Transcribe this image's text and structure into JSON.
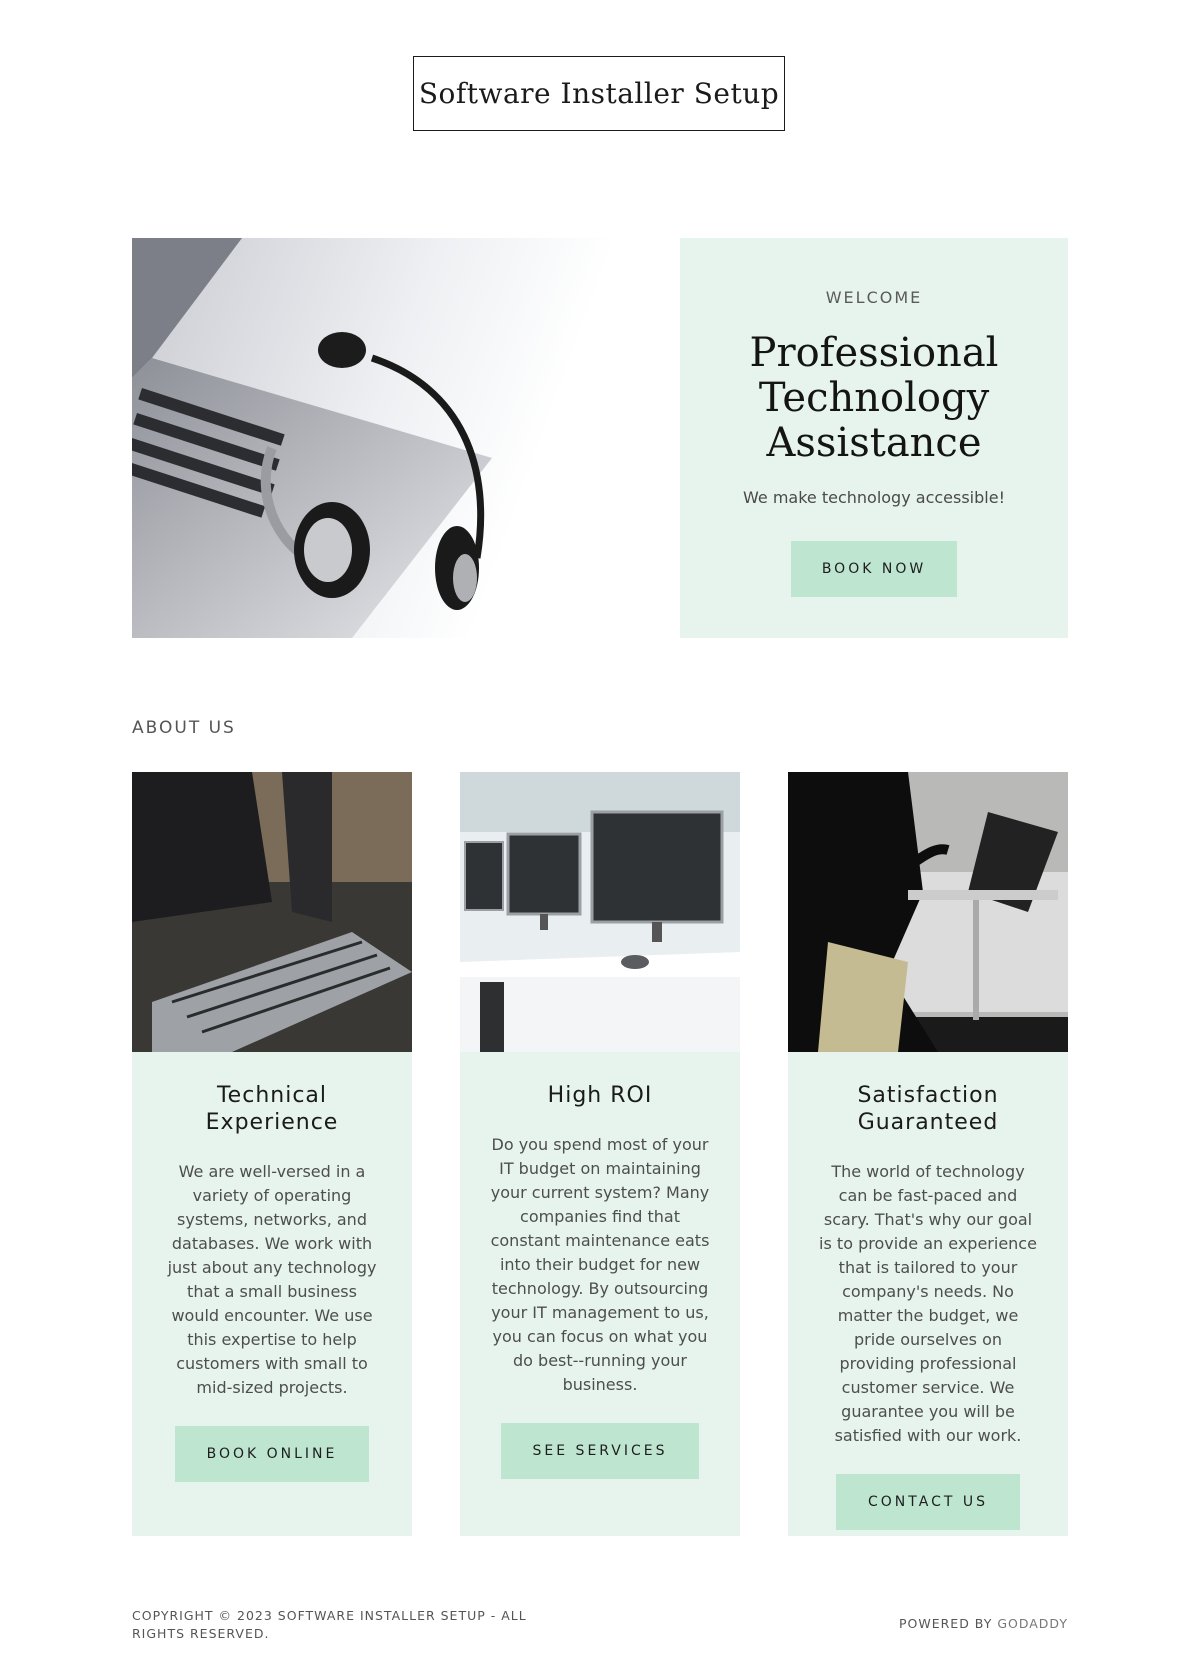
{
  "header": {
    "site_title": "Software Installer Setup"
  },
  "hero": {
    "eyebrow": "WELCOME",
    "title": "Professional Technology Assistance",
    "subtitle": "We make technology accessible!",
    "button_label": "BOOK NOW"
  },
  "about": {
    "label": "ABOUT US",
    "cards": [
      {
        "title": "Technical Experience",
        "text": "We are well-versed in a variety of operating systems, networks, and databases. We work with just about any technology that a small business would encounter. We use this expertise to help customers with small to mid-sized projects.",
        "button_label": "BOOK ONLINE"
      },
      {
        "title": "High ROI",
        "text": "Do you spend most of your IT budget on maintaining your current system? Many companies find that constant maintenance eats into their budget for new technology. By outsourcing your IT management to us, you can focus on what you do best--running your business.",
        "button_label": "SEE SERVICES"
      },
      {
        "title": "Satisfaction Guaranteed",
        "text": "The world of technology can be fast-paced and scary. That's why our goal is to provide an experience that is tailored to your company's needs. No matter the budget, we pride ourselves on providing professional customer service. We guarantee you will be satisfied with our work.",
        "button_label": "CONTACT US"
      }
    ]
  },
  "footer": {
    "copyright": "COPYRIGHT © 2023 SOFTWARE INSTALLER SETUP - ALL RIGHTS RESERVED.",
    "powered_prefix": "POWERED BY",
    "powered_link": "GODADDY"
  },
  "colors": {
    "panel": "#e6f4ed",
    "button": "#bee5d0",
    "text": "#1b1b1b"
  }
}
